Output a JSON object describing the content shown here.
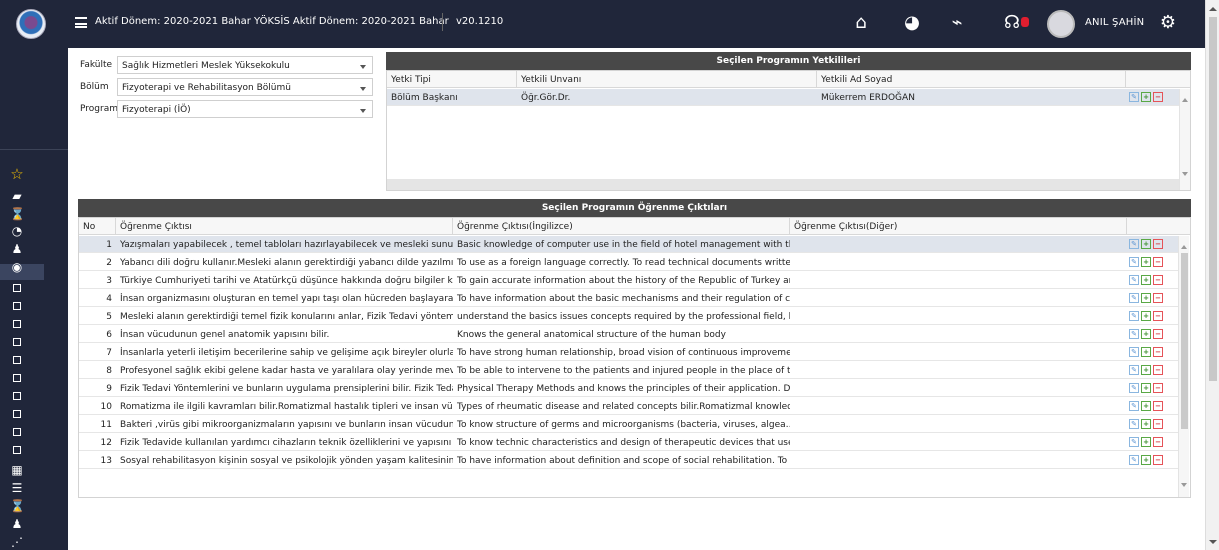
{
  "topbar": {
    "title": "Aktif Dönem: 2020-2021 Bahar YÖKSİS Aktif Dönem: 2020-2021 Bahar",
    "version": "v20.1210",
    "user": "ANIL ŞAHİN",
    "icons": [
      "home-icon",
      "pie-chart-icon",
      "trend-chart-icon",
      "chat-icon",
      "settings-icon"
    ]
  },
  "sidebar": {
    "icons": [
      "star-icon",
      "car-icon",
      "hourglass-icon",
      "pie-icon",
      "user-edit-icon",
      "globe-icon",
      "box-icon",
      "box-icon",
      "box-icon",
      "box-icon",
      "box-icon",
      "box-icon",
      "box-icon",
      "box-icon",
      "box-icon",
      "box-icon",
      "table-icon",
      "list-icon",
      "hourglass-icon",
      "users-icon",
      "network-icon"
    ]
  },
  "filters": {
    "fakulte_label": "Fakülte",
    "fakulte_value": "Sağlık Hizmetleri Meslek Yüksekokulu",
    "bolum_label": "Bölüm",
    "bolum_value": "Fizyoterapi ve Rehabilitasyon Bölümü",
    "program_label": "Program",
    "program_value": "Fizyoterapi (İÖ)"
  },
  "authorities": {
    "title": "Seçilen Programın Yetkilileri",
    "columns": [
      "Yetki Tipi",
      "Yetkili Unvanı",
      "Yetkili Ad Soyad"
    ],
    "rows": [
      {
        "yetki_tipi": "Bölüm Başkanı",
        "unvan": "Öğr.Gör.Dr.",
        "ad_soyad": "Mükerrem ERDOĞAN"
      }
    ]
  },
  "outcomes": {
    "title": "Seçilen Programın Öğrenme Çıktıları",
    "columns": [
      "No",
      "Öğrenme Çıktısı",
      "Öğrenme Çıktısı(İngilizce)",
      "Öğrenme Çıktısı(Diğer)"
    ],
    "rows": [
      {
        "no": "1",
        "tr": "Yazışmaları yapabilecek , temel tabloları hazırlayabilecek ve mesleki sunumları ç",
        "en": "Basic knowledge of computer use in the field of hotel management with the use",
        "other": ""
      },
      {
        "no": "2",
        "tr": "Yabancı dili doğru kullanır.Mesleki alanın gerektirdiği yabancı dilde yazılmış tekn",
        "en": "To use as a foreign language correctly. To read technical documents written in",
        "other": ""
      },
      {
        "no": "3",
        "tr": "Türkiye Cumhuriyeti tarihi ve Atatürkçü düşünce hakkında doğru bilgiler kazanır",
        "en": "To gain accurate information about the history of the Republic of Turkey and At",
        "other": ""
      },
      {
        "no": "4",
        "tr": "İnsan organizmasını oluşturan en temel yapı taşı olan hücreden başlayarak tüm",
        "en": "To have information about the basic mechanisms and their regulation of cells w",
        "other": ""
      },
      {
        "no": "5",
        "tr": "Mesleki alanın gerektirdiği temel fizik konularını anlar, Fizik Tedavi yöntemlerini",
        "en": "understand the basics issues concepts required by the professional field, knows",
        "other": ""
      },
      {
        "no": "6",
        "tr": "İnsan vücudunun genel anatomik yapısını bilir.",
        "en": "Knows the general anatomical structure of the human body",
        "other": ""
      },
      {
        "no": "7",
        "tr": "İnsanlarla yeterli iletişim becerilerine sahip ve gelişime açık bireyler olurlar. Top",
        "en": "To have strong human relationship, broad vision of continuous improvement an",
        "other": ""
      },
      {
        "no": "8",
        "tr": "Profesyonel sağlık ekibi gelene kadar hasta ve yaralılara olay yerinde mevcut im",
        "en": "To be able to intervene to the patients and injured people in the place of the ev",
        "other": ""
      },
      {
        "no": "9",
        "tr": "Fizik Tedavi Yöntemlerini ve bunların uygulama prensiplerini bilir. Fizik Tedavide",
        "en": "Physical Therapy Methods and knows the principles of their application. Devices",
        "other": ""
      },
      {
        "no": "10",
        "tr": "Romatizma ile ilgili kavramları bilir.Romatizmal hastalık tipleri ve insan vücudun",
        "en": "Types of rheumatic disease and related concepts bilir.Romatizmal knowledgeab",
        "other": ""
      },
      {
        "no": "11",
        "tr": "Bakteri ,virüs gibi mikroorganizmaların yapısını ve bunların insan vücuduna etkil",
        "en": "To know structure of germs and microorganisms (bacteria, viruses, algea…etc)",
        "other": ""
      },
      {
        "no": "12",
        "tr": "Fizik Tedavide kullanılan yardımcı cihazların teknik özelliklerini ve yapısını bilir.",
        "en": "To know technic characteristics and design of therapeutic devices that used in p",
        "other": ""
      },
      {
        "no": "13",
        "tr": "Sosyal rehabilitasyon kişinin sosyal ve psikolojik yönden yaşam kalitesinin artırıl",
        "en": "To have information about definition and scope of social rehabilitation. To know",
        "other": ""
      }
    ]
  },
  "colors": {
    "dark": "#20263a",
    "panel_header": "#484848",
    "selected_row": "#dfe4ec"
  }
}
